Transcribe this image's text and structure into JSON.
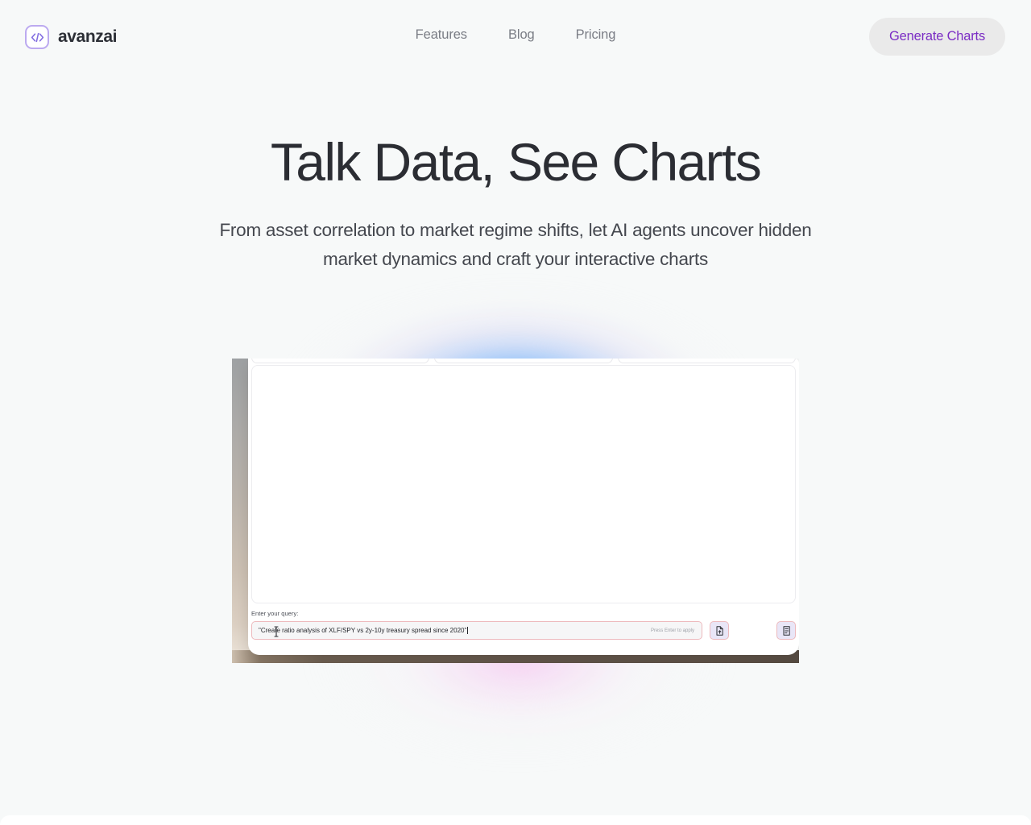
{
  "brand": {
    "name": "avanzai",
    "mark_icon": "code-brackets-icon",
    "mark_color": "#bcaaf0"
  },
  "header": {
    "nav": [
      {
        "label": "Features",
        "name": "nav-link-features"
      },
      {
        "label": "Blog",
        "name": "nav-link-blog"
      },
      {
        "label": "Pricing",
        "name": "nav-link-pricing"
      }
    ],
    "cta": {
      "label": "Generate Charts",
      "text_color": "#7b2dc4",
      "background": "#eaeaea"
    }
  },
  "hero": {
    "title": "Talk Data, See Charts",
    "subtitle": "From asset correlation to market regime shifts, let AI agents uncover hidden market dynamics and craft your interactive charts"
  },
  "app_preview": {
    "query_label": "Enter your query:",
    "query_value": "\"Create ratio analysis of XLF/SPY vs 2y-10y treasury spread since 2020\"",
    "query_hint": "Press Enter to apply",
    "primary_button_icon": "file-upload-icon",
    "secondary_button_icon": "list-document-icon",
    "cursor_icon": "text-ibeam-cursor"
  },
  "theme": {
    "page_background": "#f7f9f9",
    "glow_blue": "#2891f5",
    "glow_pink": "#f6cdf2",
    "heading_color": "#2b2d33",
    "nav_color": "#7a7d85"
  }
}
